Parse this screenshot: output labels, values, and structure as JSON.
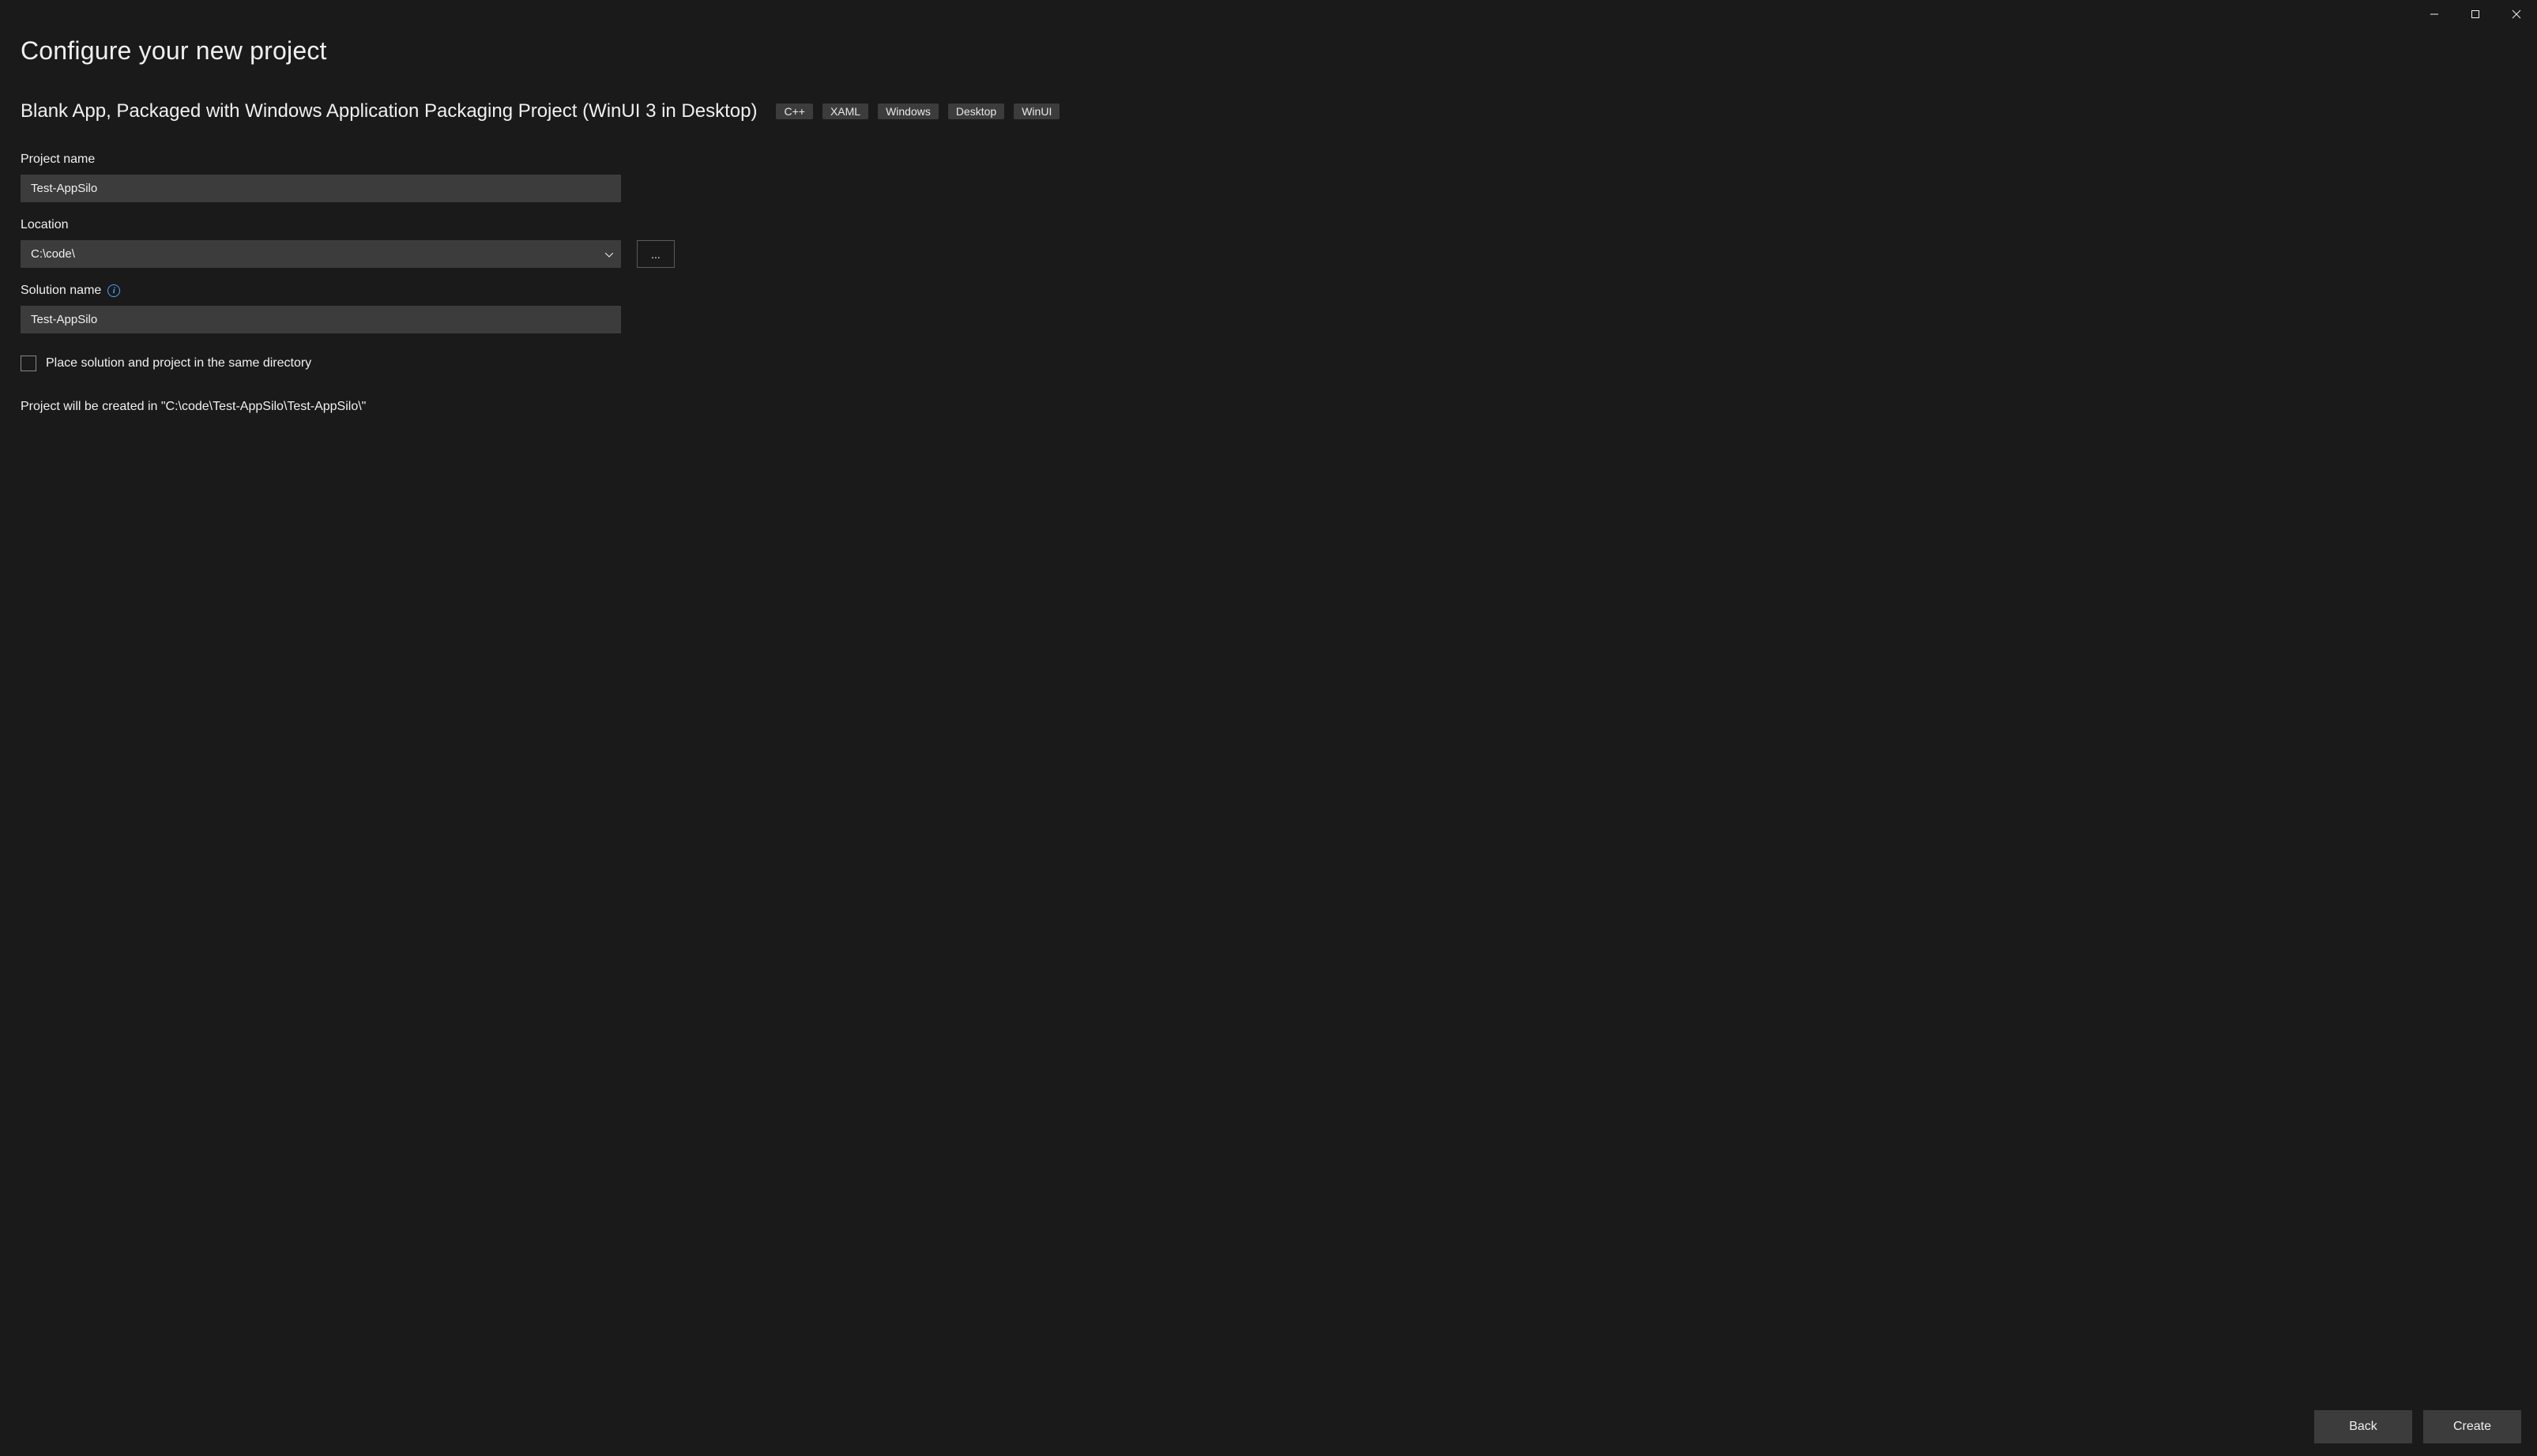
{
  "header": {
    "title": "Configure your new project"
  },
  "template": {
    "name": "Blank App, Packaged with Windows Application Packaging Project (WinUI 3 in Desktop)",
    "tags": [
      "C++",
      "XAML",
      "Windows",
      "Desktop",
      "WinUI"
    ]
  },
  "fields": {
    "project_name": {
      "label": "Project name",
      "value": "Test-AppSilo"
    },
    "location": {
      "label": "Location",
      "value": "C:\\code\\",
      "browse_label": "..."
    },
    "solution_name": {
      "label": "Solution name",
      "value": "Test-AppSilo"
    },
    "same_dir_checkbox": {
      "label": "Place solution and project in the same directory",
      "checked": false
    }
  },
  "creation_message": "Project will be created in \"C:\\code\\Test-AppSilo\\Test-AppSilo\\\"",
  "footer": {
    "back_label": "Back",
    "create_label": "Create"
  }
}
